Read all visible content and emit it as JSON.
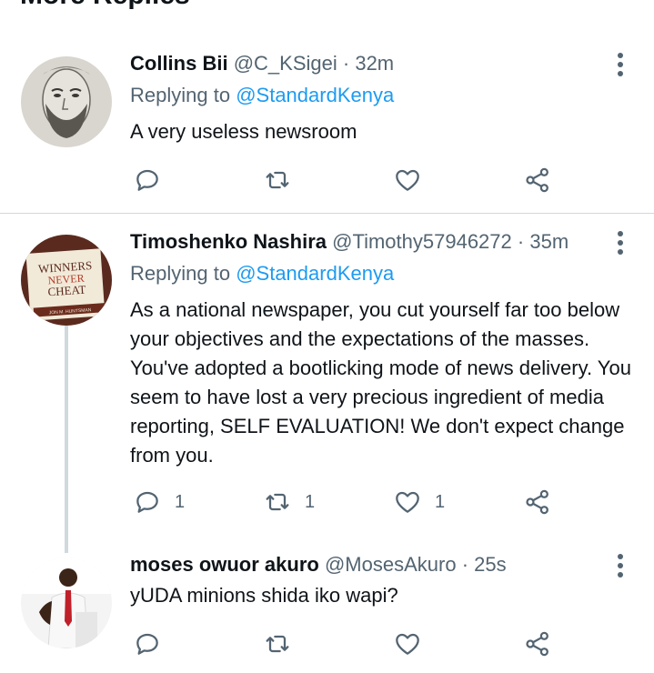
{
  "section_title": "More Replies",
  "replies": [
    {
      "name": "Collins Bii",
      "handle": "@C_KSigei",
      "time": "32m",
      "replying_prefix": "Replying to",
      "replying_to": "@StandardKenya",
      "text": "A very useless newsroom",
      "counts": {
        "reply": "",
        "retweet": "",
        "like": ""
      }
    },
    {
      "name": "Timoshenko Nashira",
      "handle": "@Timothy57946272",
      "time": "35m",
      "replying_prefix": "Replying to",
      "replying_to": "@StandardKenya",
      "text": "As a national newspaper, you cut yourself far too below your objectives and the expectations of the masses. You've adopted a bootlicking mode of news delivery. You seem to have lost a very precious ingredient of media reporting, SELF EVALUATION!  We don't expect change from you.",
      "counts": {
        "reply": "1",
        "retweet": "1",
        "like": "1"
      },
      "avatar_book": {
        "line1": "WINNERS",
        "line2": "NEVER",
        "line3": "CHEAT",
        "author": "JON M. HUNTSMAN"
      }
    },
    {
      "name": "moses owuor akuro",
      "handle": "@MosesAkuro",
      "time": "25s",
      "text": "yUDA minions shida iko wapi?",
      "counts": {
        "reply": "",
        "retweet": "",
        "like": ""
      }
    }
  ],
  "separator": "·",
  "icons": [
    "reply-icon",
    "retweet-icon",
    "like-icon",
    "share-icon",
    "more-options-icon"
  ],
  "colors": {
    "link": "#1d9bf0",
    "secondary": "#536471",
    "divider": "#cfd9de"
  }
}
